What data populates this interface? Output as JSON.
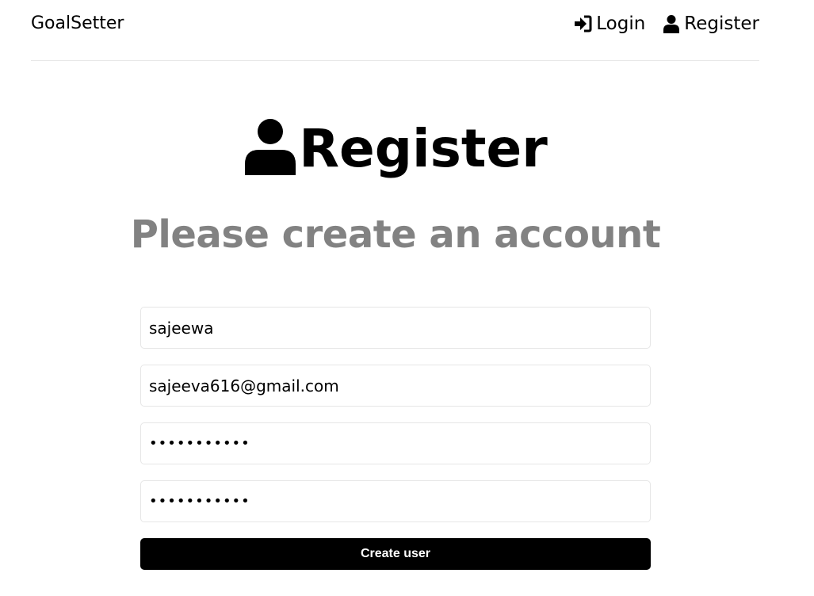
{
  "header": {
    "brand": "GoalSetter",
    "nav": {
      "login_label": "Login",
      "register_label": "Register"
    }
  },
  "page": {
    "title": "Register",
    "subtitle": "Please create an account"
  },
  "form": {
    "name_value": "sajeewa",
    "email_value": "sajeeva616@gmail.com",
    "password_value": "12345678901",
    "password_confirm_value": "12345678901",
    "submit_label": "Create user"
  },
  "icons": {
    "login": "sign-in-icon",
    "register": "user-icon",
    "heading": "user-icon"
  },
  "colors": {
    "subtitle": "#828282",
    "button_bg": "#000000",
    "button_text": "#ffffff",
    "border": "#e6e6e6"
  }
}
